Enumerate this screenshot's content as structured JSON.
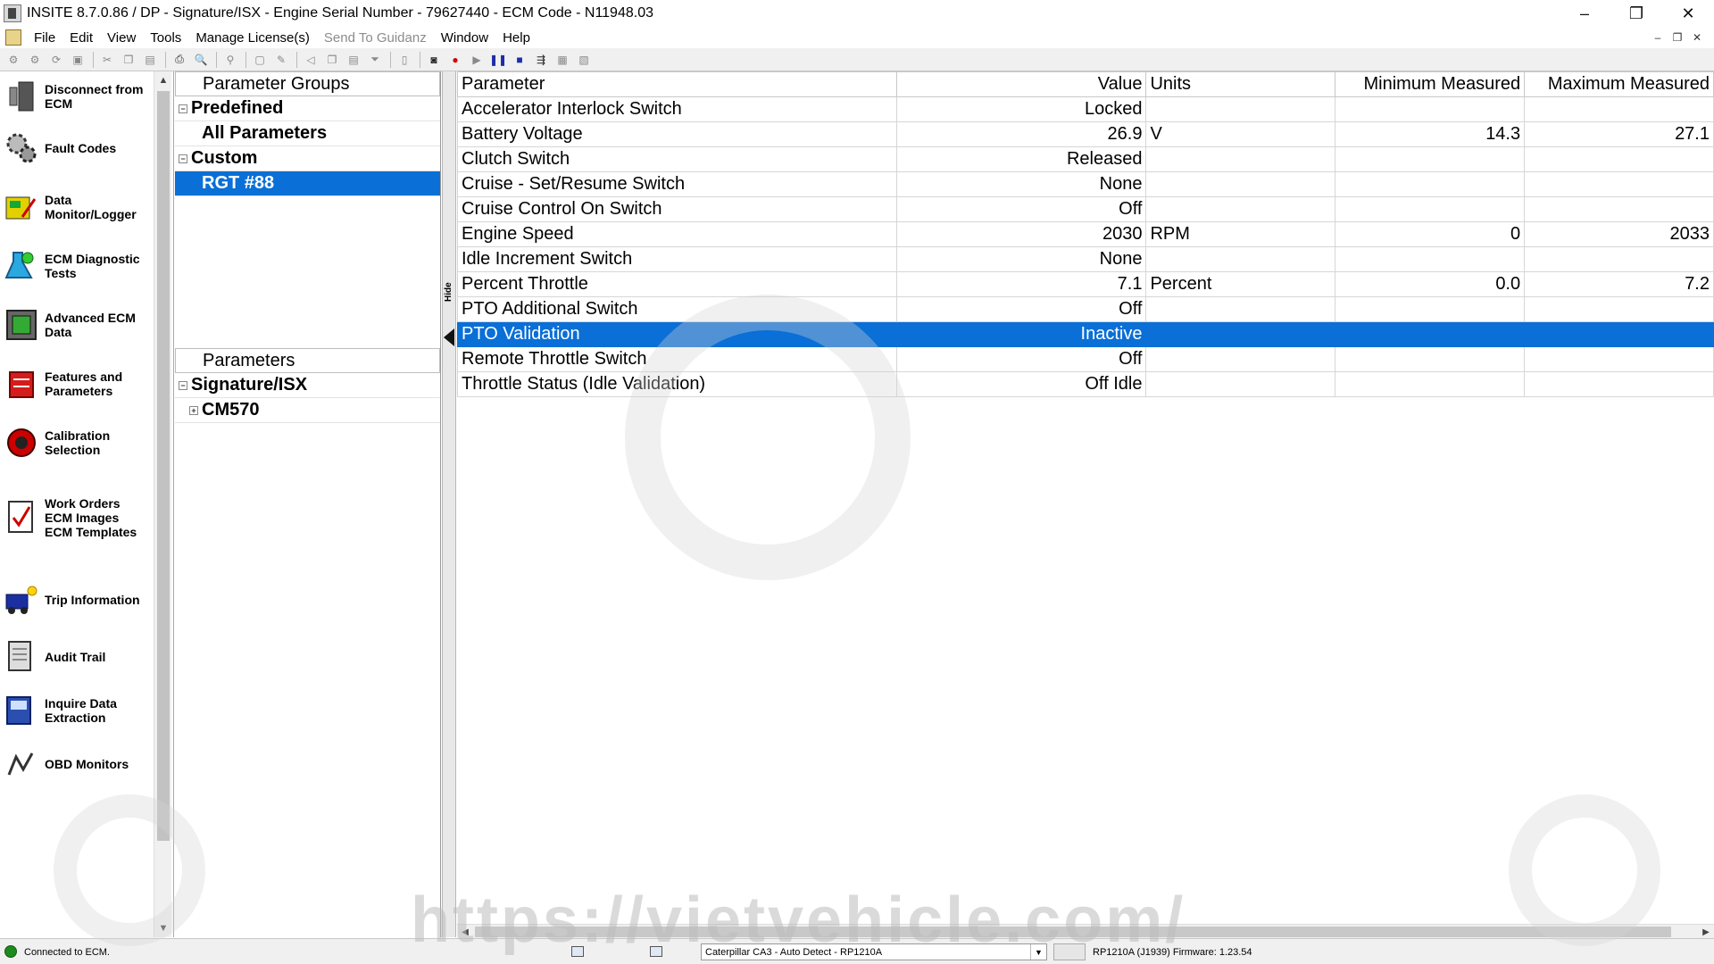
{
  "window": {
    "title": "INSITE 8.7.0.86  / DP - Signature/ISX - Engine Serial Number - 79627440 - ECM Code -  N11948.03",
    "controls": {
      "minimize": "–",
      "restore": "❐",
      "close": "✕"
    }
  },
  "menu": {
    "items": [
      {
        "label": "File",
        "enabled": true
      },
      {
        "label": "Edit",
        "enabled": true
      },
      {
        "label": "View",
        "enabled": true
      },
      {
        "label": "Tools",
        "enabled": true
      },
      {
        "label": "Manage License(s)",
        "enabled": true
      },
      {
        "label": "Send To Guidanz",
        "enabled": false
      },
      {
        "label": "Window",
        "enabled": true
      },
      {
        "label": "Help",
        "enabled": true
      }
    ]
  },
  "nav": {
    "items": [
      {
        "label": "Disconnect from\nECM",
        "icon": "disconnect-icon"
      },
      {
        "label": "Fault Codes",
        "icon": "fault-codes-icon"
      },
      {
        "label": "Data\nMonitor/Logger",
        "icon": "data-monitor-icon"
      },
      {
        "label": "ECM Diagnostic\nTests",
        "icon": "diagnostic-tests-icon"
      },
      {
        "label": "Advanced ECM\nData",
        "icon": "advanced-ecm-icon"
      },
      {
        "label": "Features and\nParameters",
        "icon": "features-icon"
      },
      {
        "label": "Calibration\nSelection",
        "icon": "calibration-icon"
      },
      {
        "label": "Work Orders\nECM Images\nECM Templates",
        "icon": "work-orders-icon"
      },
      {
        "label": "Trip Information",
        "icon": "trip-icon"
      },
      {
        "label": "Audit Trail",
        "icon": "audit-trail-icon"
      },
      {
        "label": "Inquire Data\nExtraction",
        "icon": "inquire-icon"
      },
      {
        "label": "OBD Monitors",
        "icon": "obd-icon"
      }
    ]
  },
  "parameter_groups": {
    "header": "Parameter Groups",
    "predefined": "Predefined",
    "all_parameters": "All Parameters",
    "custom": "Custom",
    "selected_group": "RGT #88"
  },
  "parameters_tree": {
    "header": "Parameters",
    "root": "Signature/ISX",
    "child": "CM570"
  },
  "splitter": {
    "hide_label": "Hide"
  },
  "grid": {
    "columns": {
      "parameter": "Parameter",
      "value": "Value",
      "units": "Units",
      "min": "Minimum Measured",
      "max": "Maximum Measured"
    },
    "rows": [
      {
        "parameter": "Accelerator Interlock Switch",
        "value": "Locked",
        "units": "",
        "min": "",
        "max": ""
      },
      {
        "parameter": "Battery Voltage",
        "value": "26.9",
        "units": "V",
        "min": "14.3",
        "max": "27.1"
      },
      {
        "parameter": "Clutch Switch",
        "value": "Released",
        "units": "",
        "min": "",
        "max": ""
      },
      {
        "parameter": "Cruise - Set/Resume Switch",
        "value": "None",
        "units": "",
        "min": "",
        "max": ""
      },
      {
        "parameter": "Cruise Control On Switch",
        "value": "Off",
        "units": "",
        "min": "",
        "max": ""
      },
      {
        "parameter": "Engine Speed",
        "value": "2030",
        "units": "RPM",
        "min": "0",
        "max": "2033"
      },
      {
        "parameter": "Idle Increment Switch",
        "value": "None",
        "units": "",
        "min": "",
        "max": ""
      },
      {
        "parameter": "Percent Throttle",
        "value": "7.1",
        "units": "Percent",
        "min": "0.0",
        "max": "7.2"
      },
      {
        "parameter": "PTO Additional Switch",
        "value": "Off",
        "units": "",
        "min": "",
        "max": ""
      },
      {
        "parameter": "PTO Validation",
        "value": "Inactive",
        "units": "",
        "min": "",
        "max": "",
        "selected": true
      },
      {
        "parameter": "Remote Throttle Switch",
        "value": "Off",
        "units": "",
        "min": "",
        "max": ""
      },
      {
        "parameter": "Throttle Status (Idle Validation)",
        "value": "Off Idle",
        "units": "",
        "min": "",
        "max": ""
      }
    ]
  },
  "status": {
    "connection": "Connected to ECM.",
    "adapter": "Caterpillar CA3 - Auto Detect - RP1210A",
    "firmware": "RP1210A (J1939)  Firmware: 1.23.54"
  },
  "watermark": {
    "url": "https://vietvehicle.com/"
  },
  "colors": {
    "selection": "#0a6fd6",
    "status_connected": "#1d8a1d"
  }
}
